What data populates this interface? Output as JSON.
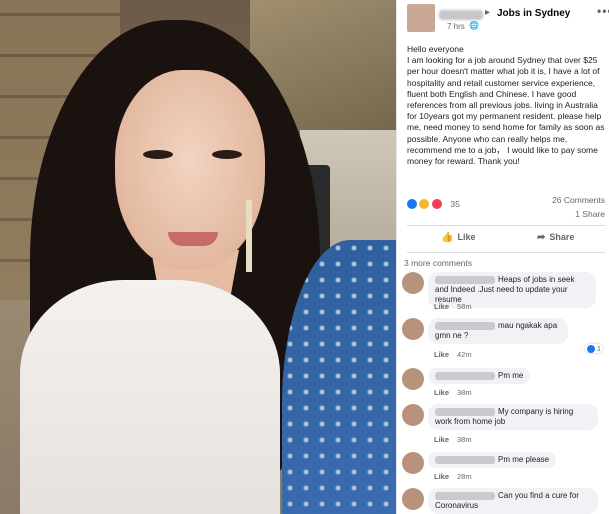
{
  "post": {
    "group_name": "Jobs in Sydney",
    "arrow": "▸",
    "time": "7 hrs",
    "globe": "🌐",
    "more_icon": "•••",
    "text": "Hello everyone\nI am looking for a job around Sydney that over $25 per hour doesn't matter what job it is, I have a lot of hospitality and retail customer service experience, fluent both English and Chinese. I have good references from all previous jobs. living in Australia for 10years got my permanent resident. please help me, need money to send home for family as soon as possible. Anyone who can really helps me, recommend me to a job， I would like to pay some money for reward. Thank you!",
    "reaction_count": "35",
    "comments_count": "26 Comments",
    "share_count": "1 Share",
    "like_label": "Like",
    "share_label": "Share",
    "like_icon": "👍",
    "share_icon": "➦"
  },
  "comments": {
    "more_label": "3 more comments",
    "items": [
      {
        "text": "Heaps of jobs in seek and Indeed .Just need to update your resume",
        "like": "Like",
        "time": "58m",
        "reaction": ""
      },
      {
        "text": "mau ngakak apa gmn ne ?",
        "like": "Like",
        "time": "42m",
        "reaction": "1"
      },
      {
        "text": "Pm me",
        "like": "Like",
        "time": "38m",
        "reaction": ""
      },
      {
        "text": "My company is hiring work from home job",
        "like": "Like",
        "time": "38m",
        "reaction": ""
      },
      {
        "text": "Pm me please",
        "like": "Like",
        "time": "28m",
        "reaction": ""
      },
      {
        "text": "Can you find a cure for Coronavirus",
        "like": "",
        "time": "",
        "reaction": ""
      }
    ]
  },
  "colors": {
    "accent": "#1877f2",
    "text": "#1c1e21",
    "muted": "#65676b",
    "bubble": "#f0f2f5"
  }
}
